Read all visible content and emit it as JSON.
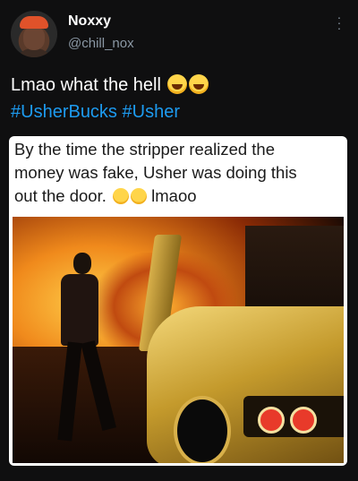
{
  "author": {
    "display_name": "Noxxy",
    "handle": "@chill_nox"
  },
  "tweet": {
    "text": "Lmao what the hell",
    "hashtags": [
      "#UsherBucks",
      "#Usher"
    ]
  },
  "quoted_image": {
    "caption_line1": "By the time the stripper realized the",
    "caption_line2": "money was fake, Usher was doing this",
    "caption_line3_prefix": "out the door.",
    "caption_line3_suffix": "lmaoo"
  },
  "icons": {
    "more": "more-vertical-icon",
    "emoji": "grinning-squinting-face-emoji"
  },
  "colors": {
    "background": "#0f0f10",
    "hashtag": "#1d9bf0",
    "handle": "#8b98a5"
  }
}
